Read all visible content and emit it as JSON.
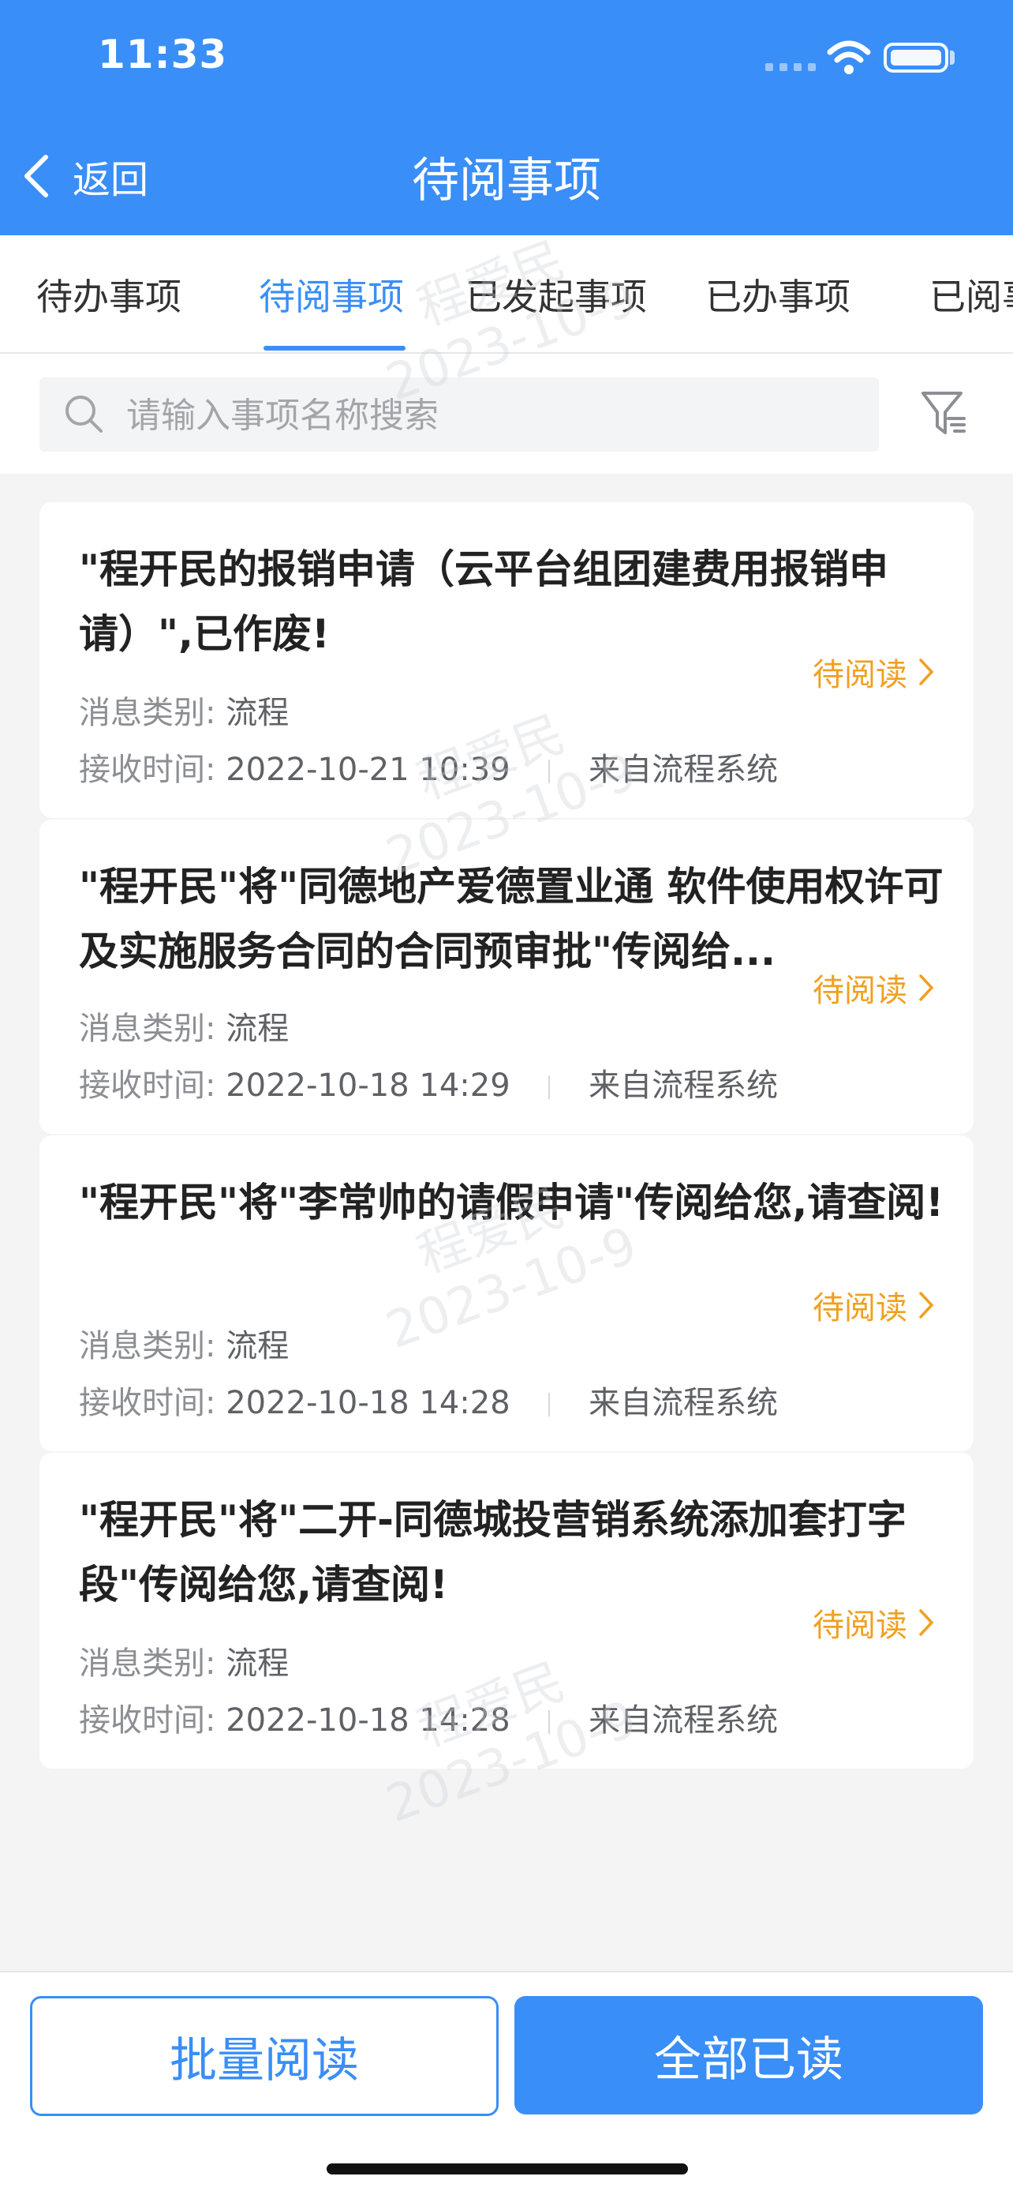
{
  "status_bar": {
    "time": "11:33"
  },
  "nav": {
    "back_label": "返回",
    "title": "待阅事项"
  },
  "tabs": [
    {
      "label": "待办事项",
      "active": false
    },
    {
      "label": "待阅事项",
      "active": true
    },
    {
      "label": "已发起事项",
      "active": false
    },
    {
      "label": "已办事项",
      "active": false
    },
    {
      "label": "已阅事",
      "active": false
    }
  ],
  "search": {
    "placeholder": "请输入事项名称搜索",
    "value": ""
  },
  "watermark": {
    "name": "程爱民",
    "date": "2023-10-9"
  },
  "meta_labels": {
    "category": "消息类别:",
    "received": "接收时间:"
  },
  "items": [
    {
      "title": "\"程开民的报销申请（云平台组团建费用报销申请）\",已作废!",
      "category": "流程",
      "time": "2022-10-21 10:39",
      "source": "来自流程系统",
      "status": "待阅读"
    },
    {
      "title": "\"程开民\"将\"同德地产爱德置业通 软件使用权许可及实施服务合同的合同预审批\"传阅给...",
      "category": "流程",
      "time": "2022-10-18 14:29",
      "source": "来自流程系统",
      "status": "待阅读"
    },
    {
      "title": "\"程开民\"将\"李常帅的请假申请\"传阅给您,请查阅!",
      "category": "流程",
      "time": "2022-10-18 14:28",
      "source": "来自流程系统",
      "status": "待阅读"
    },
    {
      "title": "\"程开民\"将\"二开-同德城投营销系统添加套打字段\"传阅给您,请查阅!",
      "category": "流程",
      "time": "2022-10-18 14:28",
      "source": "来自流程系统",
      "status": "待阅读"
    }
  ],
  "actions": {
    "batch_read": "批量阅读",
    "mark_all_read": "全部已读"
  },
  "colors": {
    "primary": "#3a8ef7",
    "status_pending": "#f0a020"
  }
}
